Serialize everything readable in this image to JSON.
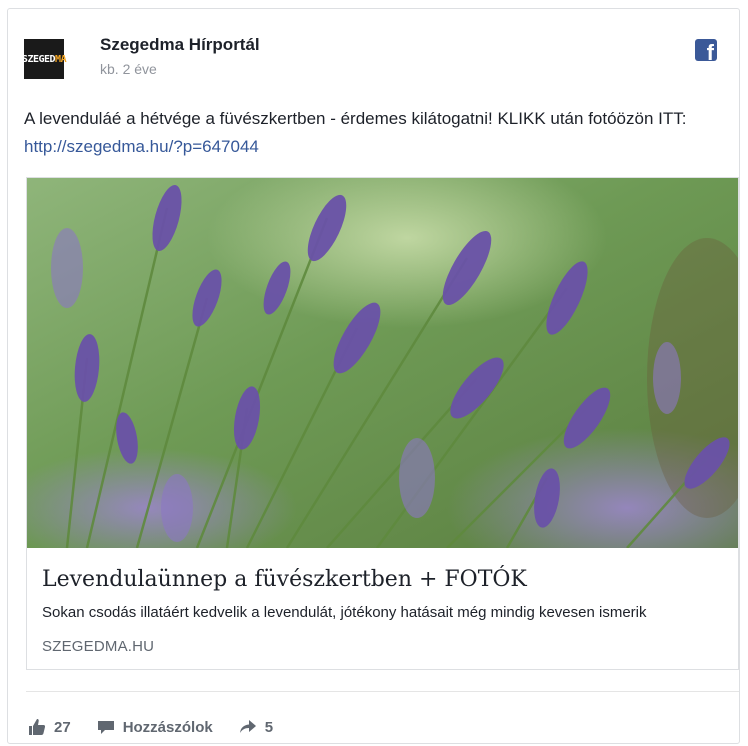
{
  "post": {
    "page_name": "Szegedma Hírportál",
    "timestamp": "kb. 2 éve",
    "avatar": {
      "text_main": "SZEGED",
      "text_accent": "MA",
      "accent_color": "#f5a623"
    },
    "text_main": "A levenduláé a hétvége a füvészkertben - érdemes kilátogatni! KLIKK után fotóözön ITT: ",
    "link_url": "http://szegedma.hu/?p=647044",
    "network_icon": "facebook-icon",
    "brand_color": "#3b5998"
  },
  "link_preview": {
    "image": "lavender-photo",
    "title": "Levendulaünnep a füvészkertben + FOTÓK",
    "description": "Sokan csodás illatáért kedvelik a levendulát, jótékony hatásait még mindig kevesen ismerik",
    "domain": "SZEGEDMA.HU"
  },
  "actions": {
    "likes": "27",
    "comments_label": "Hozzászólok",
    "shares": "5"
  }
}
